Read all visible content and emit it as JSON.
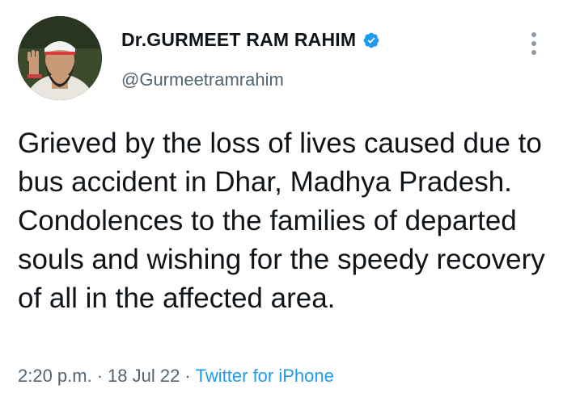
{
  "author": {
    "display_name": "Dr.GURMEET RAM RAHIM",
    "handle": "@Gurmeetramrahim",
    "verified": true
  },
  "tweet": {
    "text": "Grieved by the loss of lives caused due to bus accident in Dhar, Madhya Pradesh. Condolences to the families of departed souls and wishing for the speedy recovery of all in the affected area."
  },
  "meta": {
    "time": "2:20 p.m.",
    "separator": "·",
    "date": "18 Jul 22",
    "source": "Twitter for iPhone"
  },
  "icons": {
    "verified": "verified-badge-icon",
    "more": "more-options-icon"
  },
  "colors": {
    "primary_text": "#0f1419",
    "secondary_text": "#536471",
    "accent": "#1d9bf0",
    "background": "#ffffff"
  }
}
